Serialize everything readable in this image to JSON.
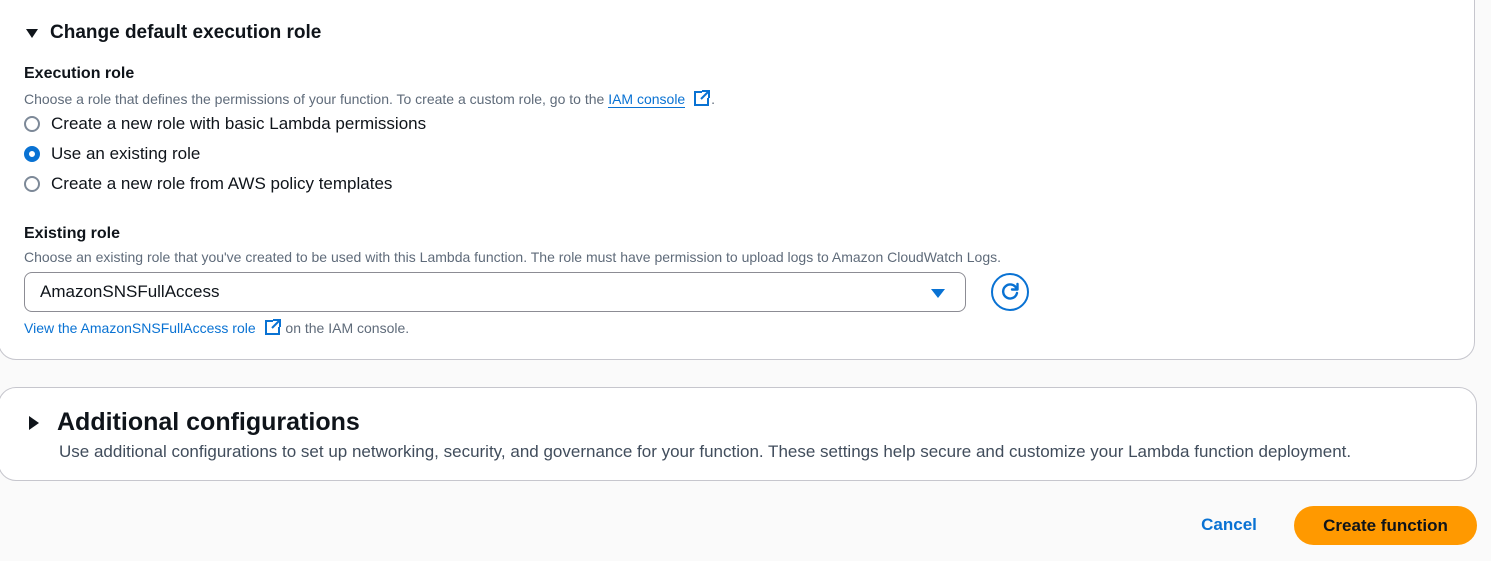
{
  "execution_section": {
    "header": "Change default execution role",
    "execution_role": {
      "label": "Execution role",
      "description_prefix": "Choose a role that defines the permissions of your function. To create a custom role, go to the",
      "iam_link": "IAM console",
      "description_suffix": ".",
      "options": [
        {
          "label": "Create a new role with basic Lambda permissions",
          "selected": false
        },
        {
          "label": "Use an existing role",
          "selected": true
        },
        {
          "label": "Create a new role from AWS policy templates",
          "selected": false
        }
      ]
    },
    "existing_role": {
      "label": "Existing role",
      "description": "Choose an existing role that you've created to be used with this Lambda function. The role must have permission to upload logs to Amazon CloudWatch Logs.",
      "selected_value": "AmazonSNSFullAccess",
      "view_link": "View the AmazonSNSFullAccess role",
      "view_suffix": "on the IAM console."
    }
  },
  "additional_configurations": {
    "title": "Additional configurations",
    "description": "Use additional configurations to set up networking, security, and governance for your function. These settings help secure and customize your Lambda function deployment."
  },
  "footer": {
    "cancel_label": "Cancel",
    "create_label": "Create function"
  },
  "colors": {
    "link_blue": "#0972d3",
    "primary_orange": "#ff9900",
    "border_gray": "#c6c6cd"
  },
  "icons": {
    "section_toggle": "caret-down-icon",
    "external": "external-link-icon",
    "dropdown": "dropdown-triangle-icon",
    "refresh": "refresh-icon",
    "expand": "caret-right-icon"
  }
}
